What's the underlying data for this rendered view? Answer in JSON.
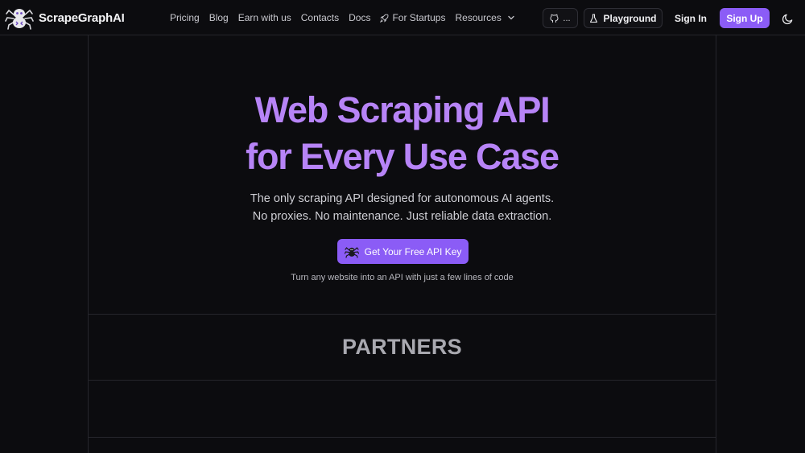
{
  "header": {
    "brand": "ScrapeGraphAI",
    "nav": [
      {
        "label": "Pricing",
        "icon": null
      },
      {
        "label": "Blog",
        "icon": null
      },
      {
        "label": "Earn with us",
        "icon": null
      },
      {
        "label": "Contacts",
        "icon": null
      },
      {
        "label": "Docs",
        "icon": null
      },
      {
        "label": "For Startups",
        "icon": "rocket-icon"
      },
      {
        "label": "Resources",
        "icon": "chevron-down-icon"
      }
    ],
    "github_label": "...",
    "playground_label": "Playground",
    "signin_label": "Sign In",
    "signup_label": "Sign Up"
  },
  "hero": {
    "title_line1": "Web Scraping API",
    "title_line2": "for Every Use Case",
    "subtitle_line1": "The only scraping API designed for autonomous AI agents.",
    "subtitle_line2": "No proxies. No maintenance. Just reliable data extraction.",
    "cta_label": "Get Your Free API Key",
    "note": "Turn any website into an API with just a few lines of code"
  },
  "partners": {
    "title": "PARTNERS"
  },
  "colors": {
    "background": "#0c0c0f",
    "accent": "#8b5cf6",
    "title": "#b784f7",
    "border": "#26262c"
  }
}
